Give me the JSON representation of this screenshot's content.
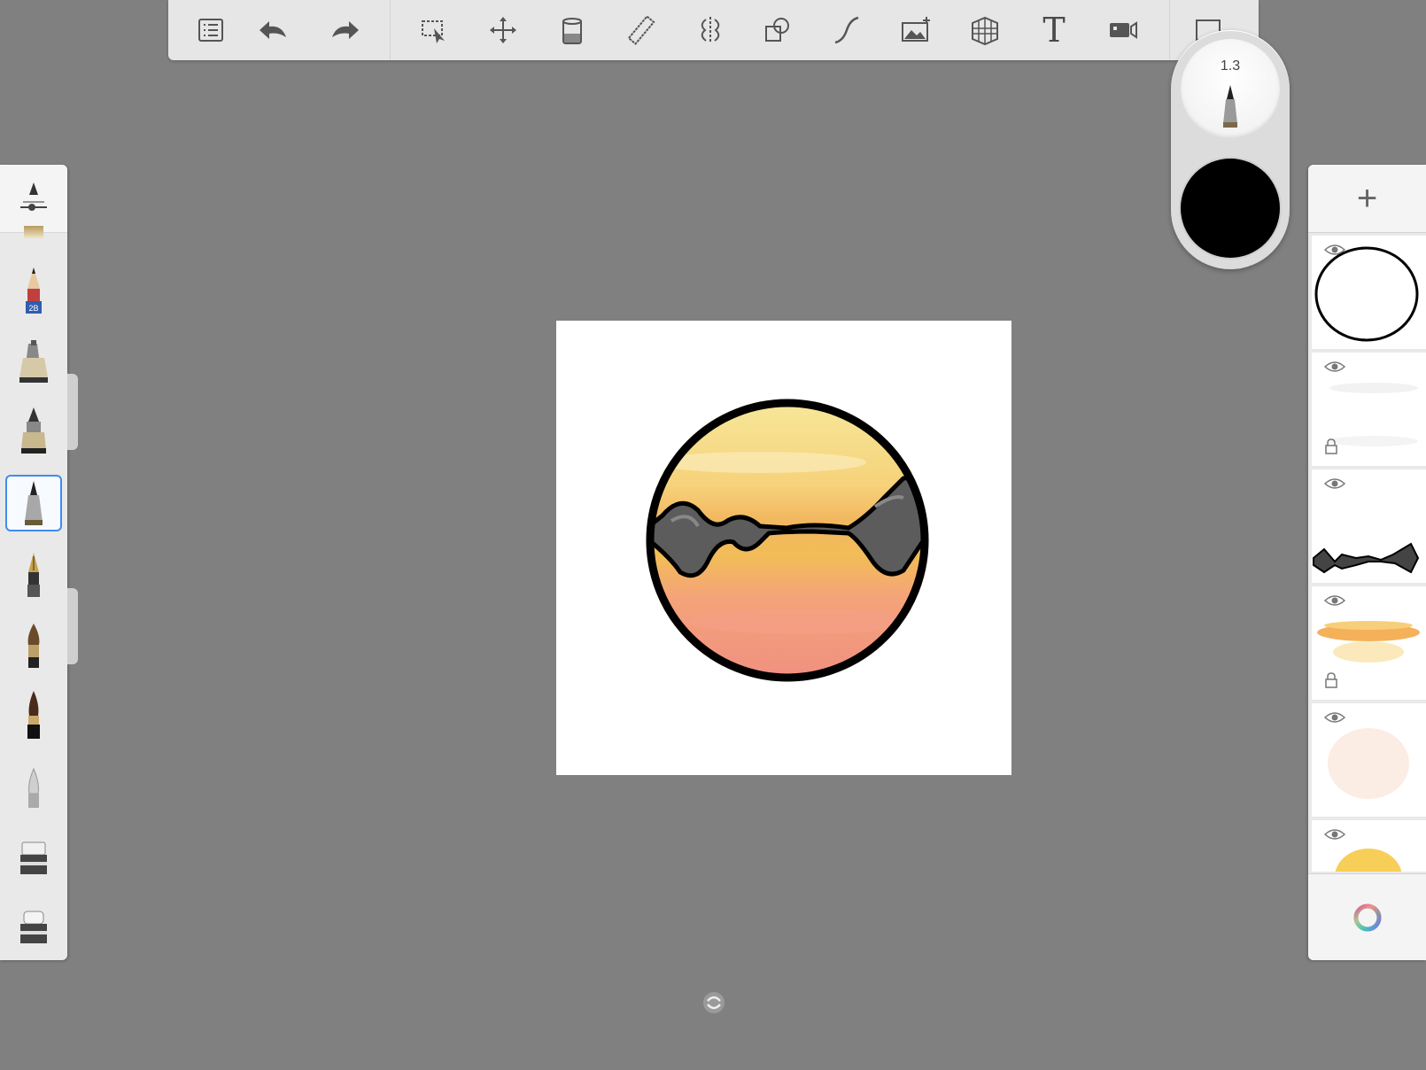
{
  "toolbar": {
    "buttons": [
      {
        "name": "layer-list-icon"
      },
      {
        "name": "undo-icon"
      },
      {
        "name": "redo-icon"
      },
      {
        "name": "selection-icon"
      },
      {
        "name": "transform-icon"
      },
      {
        "name": "fill-icon"
      },
      {
        "name": "ruler-icon"
      },
      {
        "name": "symmetry-icon"
      },
      {
        "name": "shapes-icon"
      },
      {
        "name": "stroke-icon"
      },
      {
        "name": "add-image-icon"
      },
      {
        "name": "perspective-icon"
      },
      {
        "name": "text-icon"
      },
      {
        "name": "record-icon"
      },
      {
        "name": "fullscreen-icon"
      }
    ],
    "text_glyph": "T"
  },
  "brush_puck": {
    "size_value": "1.3",
    "color": "#000000"
  },
  "brushes": [
    {
      "name": "brush-settings-icon"
    },
    {
      "name": "pencil-icon",
      "badge": "2B"
    },
    {
      "name": "airbrush-icon"
    },
    {
      "name": "marker-icon"
    },
    {
      "name": "ballpoint-pen-icon",
      "selected": true
    },
    {
      "name": "fountain-pen-icon"
    },
    {
      "name": "paintbrush-icon"
    },
    {
      "name": "ink-brush-icon"
    },
    {
      "name": "smudge-icon"
    },
    {
      "name": "eraser-icon"
    },
    {
      "name": "eraser-alt-icon"
    }
  ],
  "layers": {
    "add_label": "+",
    "items": [
      {
        "name": "layer-circle-outline",
        "locked": false
      },
      {
        "name": "layer-haze",
        "locked": true
      },
      {
        "name": "layer-mountains",
        "locked": false
      },
      {
        "name": "layer-sunset-stripe",
        "locked": true
      },
      {
        "name": "layer-pink-wash",
        "locked": false
      },
      {
        "name": "layer-sun",
        "locked": false
      }
    ]
  },
  "colors": {
    "background": "#808080",
    "accent": "#3f8cf0"
  }
}
